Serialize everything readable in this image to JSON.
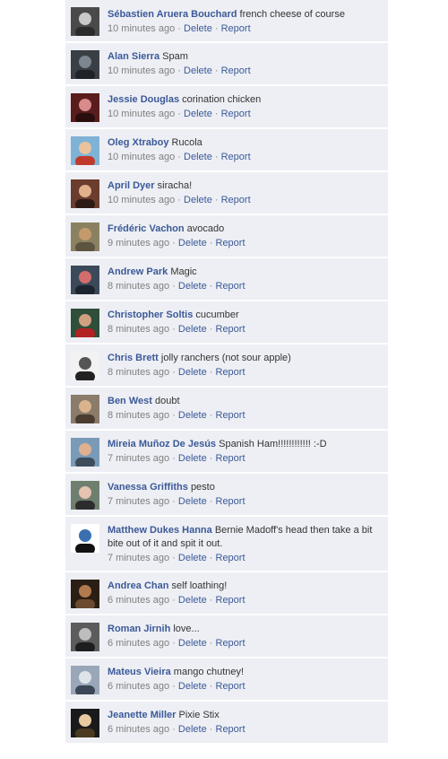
{
  "comments": [
    {
      "name": "Sébastien Aruera Bouchard",
      "text": "french cheese of course",
      "time": "10 minutes ago",
      "delete": "Delete",
      "report": "Report",
      "colors": [
        "#4a4a4a",
        "#c9c9c9",
        "#2b2b2b"
      ]
    },
    {
      "name": "Alan Sierra",
      "text": "Spam",
      "time": "10 minutes ago",
      "delete": "Delete",
      "report": "Report",
      "colors": [
        "#3a3f45",
        "#7c8691",
        "#1f2226"
      ]
    },
    {
      "name": "Jessie Douglas",
      "text": "corination chicken",
      "time": "10 minutes ago",
      "delete": "Delete",
      "report": "Report",
      "colors": [
        "#5a1d1d",
        "#d98a8a",
        "#2a0e0e"
      ]
    },
    {
      "name": "Oleg Xtraboy",
      "text": "Rucola",
      "time": "10 minutes ago",
      "delete": "Delete",
      "report": "Report",
      "colors": [
        "#7fb3d5",
        "#e8c39e",
        "#c0392b"
      ]
    },
    {
      "name": "April Dyer",
      "text": "siracha!",
      "time": "10 minutes ago",
      "delete": "Delete",
      "report": "Report",
      "colors": [
        "#6b3d2e",
        "#e2b08a",
        "#2e1a14"
      ]
    },
    {
      "name": "Frédéric Vachon",
      "text": "avocado",
      "time": "9 minutes ago",
      "delete": "Delete",
      "report": "Report",
      "colors": [
        "#8b8161",
        "#c49a6c",
        "#5c5440"
      ]
    },
    {
      "name": "Andrew Park",
      "text": "Magic",
      "time": "8 minutes ago",
      "delete": "Delete",
      "report": "Report",
      "colors": [
        "#3b4a5a",
        "#d36c6c",
        "#1c2430"
      ]
    },
    {
      "name": "Christopher Soltis",
      "text": "cucumber",
      "time": "8 minutes ago",
      "delete": "Delete",
      "report": "Report",
      "colors": [
        "#2f4f3a",
        "#d0a080",
        "#b22222"
      ]
    },
    {
      "name": "Chris Brett",
      "text": "jolly ranchers (not sour apple)",
      "time": "8 minutes ago",
      "delete": "Delete",
      "report": "Report",
      "colors": [
        "#f2f2f2",
        "#555555",
        "#222222"
      ]
    },
    {
      "name": "Ben West",
      "text": "doubt",
      "time": "8 minutes ago",
      "delete": "Delete",
      "report": "Report",
      "colors": [
        "#8a7b6a",
        "#d9b38c",
        "#4a3d30"
      ]
    },
    {
      "name": "Mireia Muñoz De Jesús",
      "text": "Spanish Ham!!!!!!!!!!!! :-D",
      "time": "7 minutes ago",
      "delete": "Delete",
      "report": "Report",
      "colors": [
        "#7a9bb8",
        "#e0b090",
        "#3d4d5c"
      ]
    },
    {
      "name": "Vanessa Griffiths",
      "text": "pesto",
      "time": "7 minutes ago",
      "delete": "Delete",
      "report": "Report",
      "colors": [
        "#6f7f6f",
        "#e6c2b0",
        "#2c2c2c"
      ]
    },
    {
      "name": "Matthew Dukes Hanna",
      "text": "Bernie Madoff's head then take a bit bite out of it and spit it out.",
      "time": "7 minutes ago",
      "delete": "Delete",
      "report": "Report",
      "colors": [
        "#ffffff",
        "#3a6fb0",
        "#111111"
      ]
    },
    {
      "name": "Andrea Chan",
      "text": "self loathing!",
      "time": "6 minutes ago",
      "delete": "Delete",
      "report": "Report",
      "colors": [
        "#2b1e14",
        "#b07a4e",
        "#6b4a30"
      ]
    },
    {
      "name": "Roman Jirnih",
      "text": "love...",
      "time": "6 minutes ago",
      "delete": "Delete",
      "report": "Report",
      "colors": [
        "#5c5c5c",
        "#bdbdbd",
        "#1e1e1e"
      ]
    },
    {
      "name": "Mateus Vieira",
      "text": "mango chutney!",
      "time": "6 minutes ago",
      "delete": "Delete",
      "report": "Report",
      "colors": [
        "#9aa7b8",
        "#dfe4ea",
        "#3b4656"
      ]
    },
    {
      "name": "Jeanette Miller",
      "text": "Pixie Stix",
      "time": "6 minutes ago",
      "delete": "Delete",
      "report": "Report",
      "colors": [
        "#1a1a1a",
        "#e8c9a0",
        "#4a3a20"
      ]
    }
  ],
  "separator": "·",
  "icons": {
    "avatar": "profile-photo"
  },
  "theme": {
    "link": "#3b5998",
    "background": "#edeff4",
    "meta": "#808080"
  }
}
